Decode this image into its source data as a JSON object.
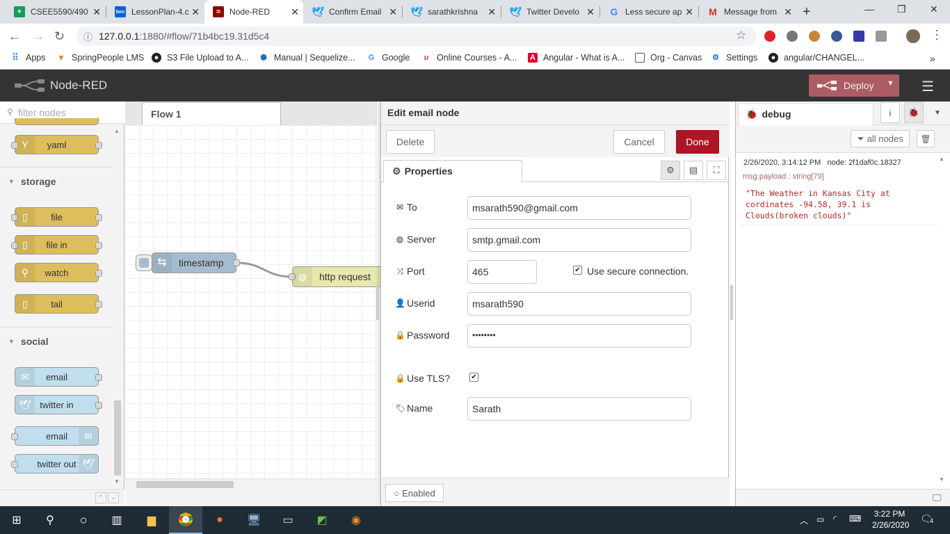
{
  "browser": {
    "tabs": [
      {
        "label": "CSEE5590/490",
        "favicon": "sheets-icon"
      },
      {
        "label": "LessonPlan-4.c",
        "favicon": "box-icon"
      },
      {
        "label": "Node-RED",
        "favicon": "node-red-icon"
      },
      {
        "label": "Confirm Email",
        "favicon": "twitter-icon"
      },
      {
        "label": "sarathkrishna",
        "favicon": "twitter-icon"
      },
      {
        "label": "Twitter Develo",
        "favicon": "twitter-icon"
      },
      {
        "label": "Less secure ap",
        "favicon": "google-icon"
      },
      {
        "label": "Message from",
        "favicon": "gmail-icon"
      }
    ],
    "address_host": "127.0.0.1",
    "address_rest": ":1880/#flow/71b4bc19.31d5c4",
    "bookmarks": [
      "Apps",
      "SpringPeople LMS",
      "S3 File Upload to A...",
      "Manual | Sequelize...",
      "Google",
      "Online Courses - A...",
      "Angular - What is A...",
      "Org - Canvas",
      "Settings",
      "angular/CHANGEL..."
    ]
  },
  "nodered": {
    "title": "Node-RED",
    "deploy_label": "Deploy",
    "palette": {
      "filter_placeholder": "filter nodes",
      "nodes_top": [
        "yaml"
      ],
      "categories": [
        "storage",
        "social"
      ],
      "storage_nodes": [
        "file",
        "file in",
        "watch",
        "tail"
      ],
      "social_nodes": [
        "email",
        "twitter in",
        "email",
        "twitter out"
      ]
    },
    "workspace": {
      "flow_tab": "Flow 1",
      "nodes": [
        "timestamp",
        "http request"
      ]
    },
    "tray": {
      "title": "Edit email node",
      "delete": "Delete",
      "cancel": "Cancel",
      "done": "Done",
      "tab": "Properties",
      "fields": {
        "to_label": "To",
        "to_value": "msarath590@gmail.com",
        "server_label": "Server",
        "server_value": "smtp.gmail.com",
        "port_label": "Port",
        "port_value": "465",
        "secure_label": "Use secure connection.",
        "userid_label": "Userid",
        "userid_value": "msarath590",
        "password_label": "Password",
        "password_value": "••••••••",
        "tls_label": "Use TLS?",
        "name_label": "Name",
        "name_value": "Sarath"
      },
      "enabled": "Enabled"
    },
    "sidebar": {
      "tab": "debug",
      "filter": "all nodes",
      "message": {
        "timestamp": "2/26/2020, 3:14:12 PM",
        "node": "node: 2f1daf0c.18327",
        "meta": "msg.payload : string[79]",
        "payload": "\"The Weather in Kansas City at cordinates -94.58, 39.1 is Clouds(broken clouds)\""
      }
    }
  },
  "taskbar": {
    "time": "3:22 PM",
    "date": "2/26/2020",
    "notifications": "4"
  }
}
